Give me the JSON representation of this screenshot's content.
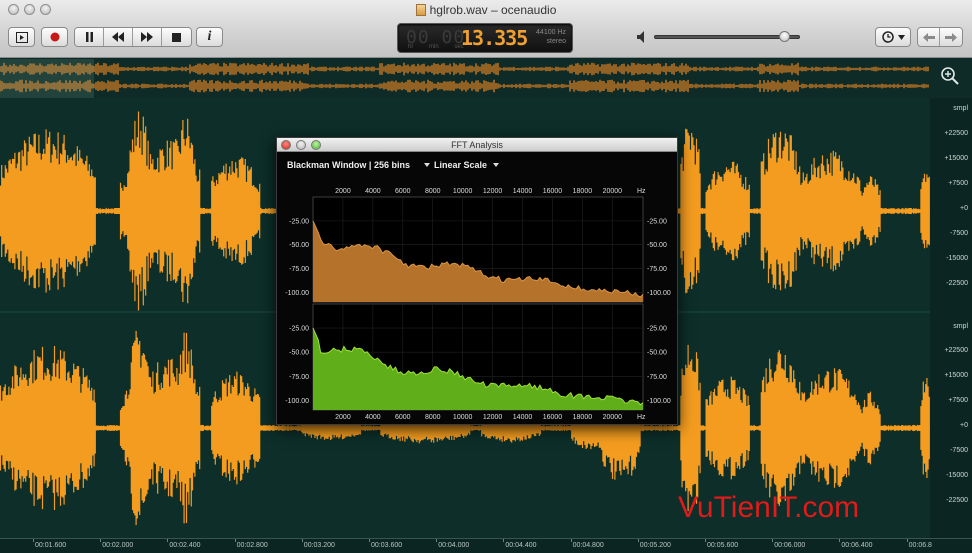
{
  "window": {
    "title": "hglrob.wav – ocenaudio"
  },
  "toolbar": {
    "buttons": [
      {
        "name": "play-selection-icon",
        "glyph": "▶"
      },
      {
        "name": "record-icon",
        "glyph": "●"
      },
      {
        "name": "pause-icon",
        "glyph": "❚❚"
      },
      {
        "name": "rewind-icon",
        "glyph": "◀◀"
      },
      {
        "name": "fast-forward-icon",
        "glyph": "▶▶"
      },
      {
        "name": "stop-icon",
        "glyph": "■"
      },
      {
        "name": "info-icon",
        "glyph": "i"
      }
    ],
    "volume_level": 0.9
  },
  "display": {
    "ghost_digits": "00 00",
    "time": "13.335",
    "sample_rate": "44100 Hz",
    "channels": "stereo",
    "units": "hr min sec"
  },
  "scale": {
    "top_unit": "smpl",
    "bottom_unit": "smpl",
    "top": [
      "+22500",
      "+15000",
      "+7500",
      "+0",
      "-7500",
      "-15000",
      "-22500"
    ],
    "bottom": [
      "+22500",
      "+15000",
      "+7500",
      "+0",
      "-7500",
      "-15000",
      "-22500"
    ]
  },
  "timeline": [
    "00:01.600",
    "00:02.000",
    "00:02.400",
    "00:02.800",
    "00:03.200",
    "00:03.600",
    "00:04.000",
    "00:04.400",
    "00:04.800",
    "00:05.200",
    "00:05.600",
    "00:06.000",
    "00:06.400",
    "00:06.8"
  ],
  "fft": {
    "title": "FFT Analysis",
    "window_select": "Blackman Window | 256 bins",
    "scale_select": "Linear Scale",
    "freq_labels": [
      "2000",
      "4000",
      "6000",
      "8000",
      "10000",
      "12000",
      "14000",
      "16000",
      "18000",
      "20000"
    ],
    "freq_unit": "Hz",
    "db_labels": [
      "-25.00",
      "-50.00",
      "-75.00",
      "-100.00"
    ],
    "colors": {
      "top": "#b5722a",
      "top_line": "#d99648",
      "bottom": "#5fae1a",
      "bottom_line": "#9fe03a"
    }
  },
  "watermark": "VuTienIT.com",
  "colors": {
    "waveform": "#f39c1f",
    "background": "#0d2e29"
  }
}
